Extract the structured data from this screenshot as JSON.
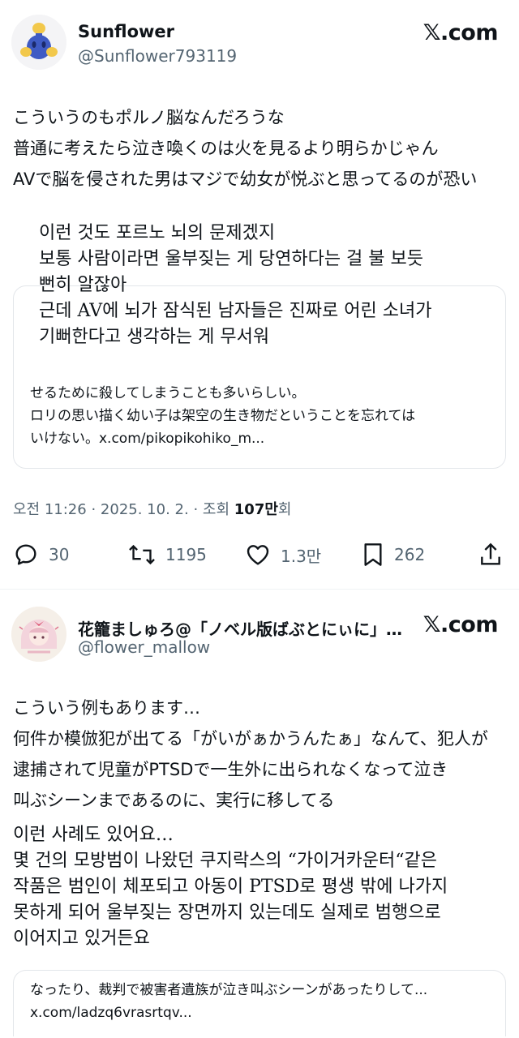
{
  "post1": {
    "author": {
      "name": "Sunflower",
      "handle": "@Sunflower793119",
      "avatar_icon": "blue-creature-avatar"
    },
    "brand": "𝕏.com",
    "text_jp": [
      "こういうのもポルノ脳なんだろうな",
      "普通に考えたら泣き喚くのは火を見るより明らかじゃん",
      "AVで脳を侵された男はマジで幼女が悦ぶと思ってるのが恐い"
    ],
    "translation_kr": [
      "이런 것도 포르노 뇌의 문제겠지",
      "보통 사람이라면 울부짖는 게 당연하다는 걸 불 보듯",
      "뻔히 알잖아",
      "근데 AV에 뇌가 잠식된 남자들은 진짜로 어린 소녀가",
      "기뻐한다고 생각하는 게 무서워"
    ],
    "quote_card": {
      "lines": [
        "せるために殺してしまうことも多いらしい。",
        "ロリの思い描く幼い子は架空の生き物だということを忘れては",
        "いけない。x.com/pikopikohiko_m..."
      ]
    },
    "meta": {
      "time": "오전 11:26",
      "date": "2025. 10. 2.",
      "views_prefix": "조회",
      "views_value": "107만",
      "views_suffix": "회",
      "separator": "·"
    },
    "actions": {
      "reply_count": "30",
      "retweet_count": "1195",
      "like_count": "1.3만",
      "bookmark_count": "262"
    }
  },
  "post2": {
    "author": {
      "name": "花籠ましゅろ@「ノベル版ばぶとにぃに」発...",
      "handle": "@flower_mallow",
      "avatar_icon": "anime-character-avatar"
    },
    "brand": "𝕏.com",
    "text_jp": [
      "こういう例もあります…",
      "何件か模倣犯が出てる「がいがぁかうんたぁ」なんて、犯人が",
      "逮捕されて児童がPTSDで一生外に出られなくなって泣き",
      "叫ぶシーンまであるのに、実行に移してる"
    ],
    "translation_kr": [
      "이런 사례도 있어요…",
      "몇 건의 모방범이 나왔던 쿠지락스의 “가이거카운터“같은",
      "작품은 범인이 체포되고 아동이 PTSD로 평생 밖에 나가지",
      "못하게 되어 울부짖는 장면까지 있는데도 실제로 범행으로",
      "이어지고 있거든요"
    ],
    "quote_card": {
      "lines": [
        "なったり、裁判で被害者遺族が泣き叫ぶシーンがあったりして...",
        "x.com/ladzq6vrasrtqv..."
      ]
    }
  },
  "colors": {
    "text": "#0f1419",
    "secondary": "#536471",
    "border": "#e3e6ea"
  }
}
